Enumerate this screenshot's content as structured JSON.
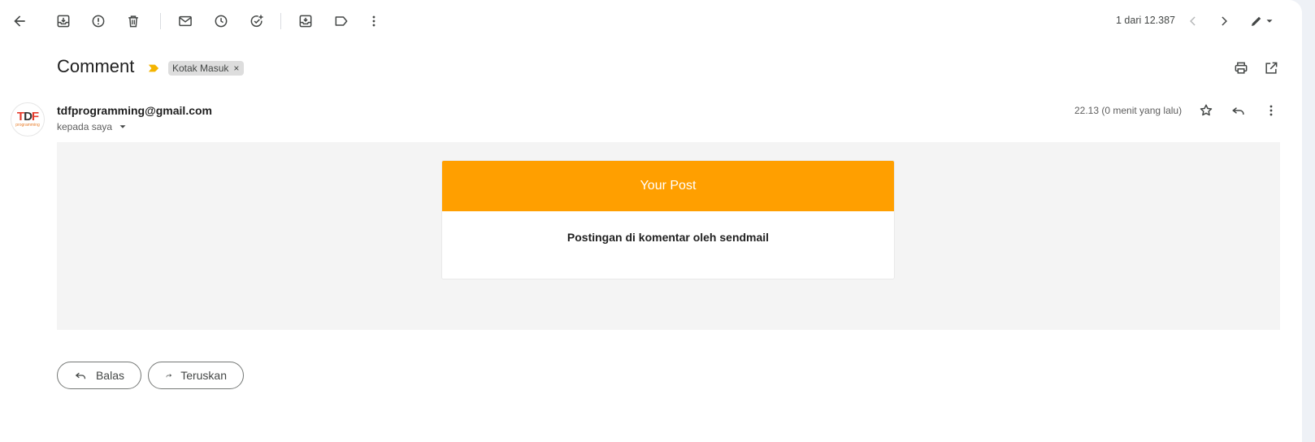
{
  "toolbar": {
    "icons": [
      "back-icon",
      "archive-icon",
      "report-spam-icon",
      "delete-icon",
      "mark-unread-icon",
      "snooze-icon",
      "add-task-icon",
      "move-to-icon",
      "label-icon",
      "more-vert-icon"
    ],
    "counter": "1 dari 12.387"
  },
  "email": {
    "subject": "Comment",
    "label": "Kotak Masuk",
    "label_remove": "×",
    "sender": "tdfprogramming@gmail.com",
    "recipient": "kepada saya",
    "time": "22.13 (0 menit yang lalu)",
    "avatar": {
      "main": "TDF",
      "sub": "programming"
    }
  },
  "card": {
    "header": "Your Post",
    "text": "Postingan di komentar oleh sendmail",
    "color": "#ff9f00"
  },
  "actions": {
    "reply": "Balas",
    "forward": "Teruskan"
  }
}
